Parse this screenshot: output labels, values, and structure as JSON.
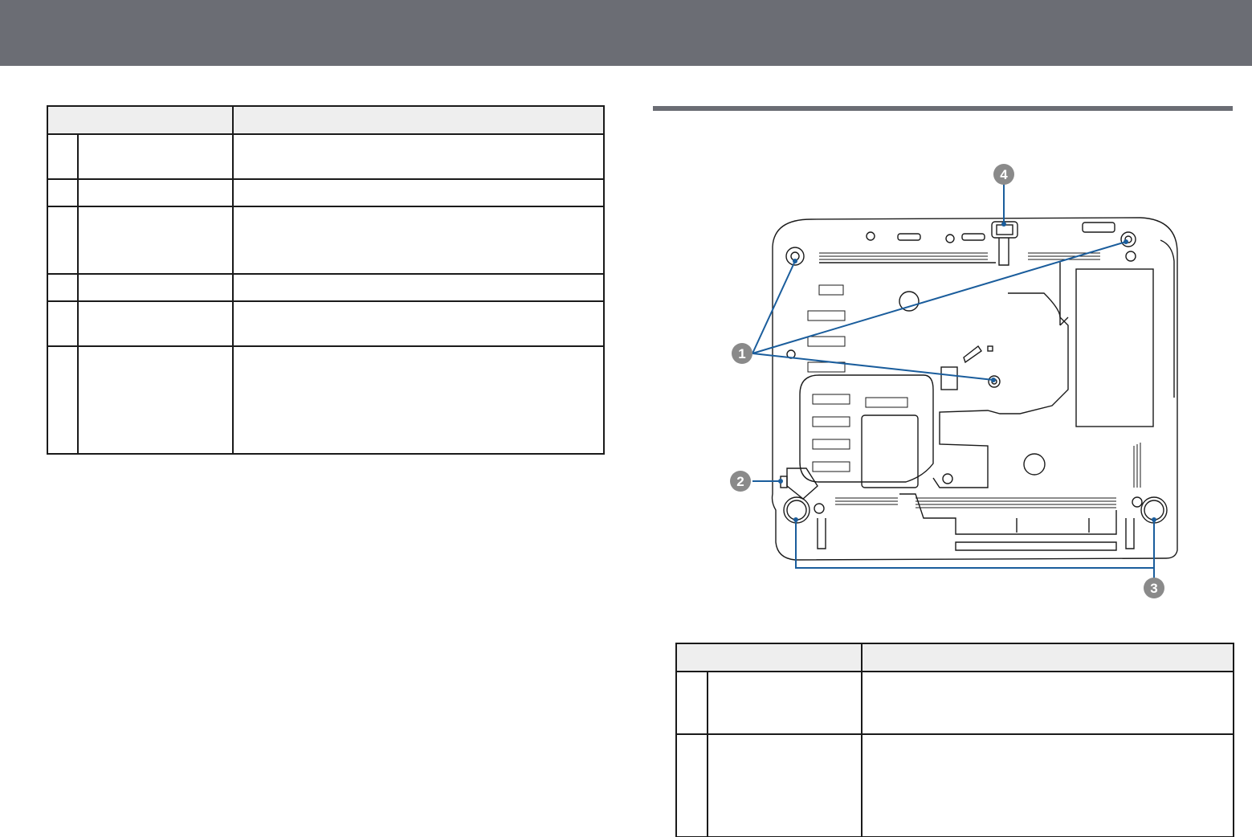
{
  "header": {
    "bar_color": "#6b6d74"
  },
  "left_table": {
    "header": [
      "",
      ""
    ],
    "rows": [
      {
        "num": "",
        "name": "",
        "description": ""
      },
      {
        "num": "",
        "name": "",
        "description": ""
      },
      {
        "num": "",
        "name": "",
        "description": ""
      },
      {
        "num": "",
        "name": "",
        "description": ""
      },
      {
        "num": "",
        "name": "",
        "description": ""
      },
      {
        "num": "",
        "name": "",
        "description": ""
      }
    ]
  },
  "diagram": {
    "callouts": [
      "1",
      "2",
      "3",
      "4"
    ],
    "callout_color": "#1a5d9c",
    "badge_color": "#8a8a8a"
  },
  "right_table": {
    "header": [
      "",
      ""
    ],
    "rows": [
      {
        "num": "",
        "name": "",
        "description": ""
      },
      {
        "num": "",
        "name": "",
        "description": ""
      }
    ]
  }
}
